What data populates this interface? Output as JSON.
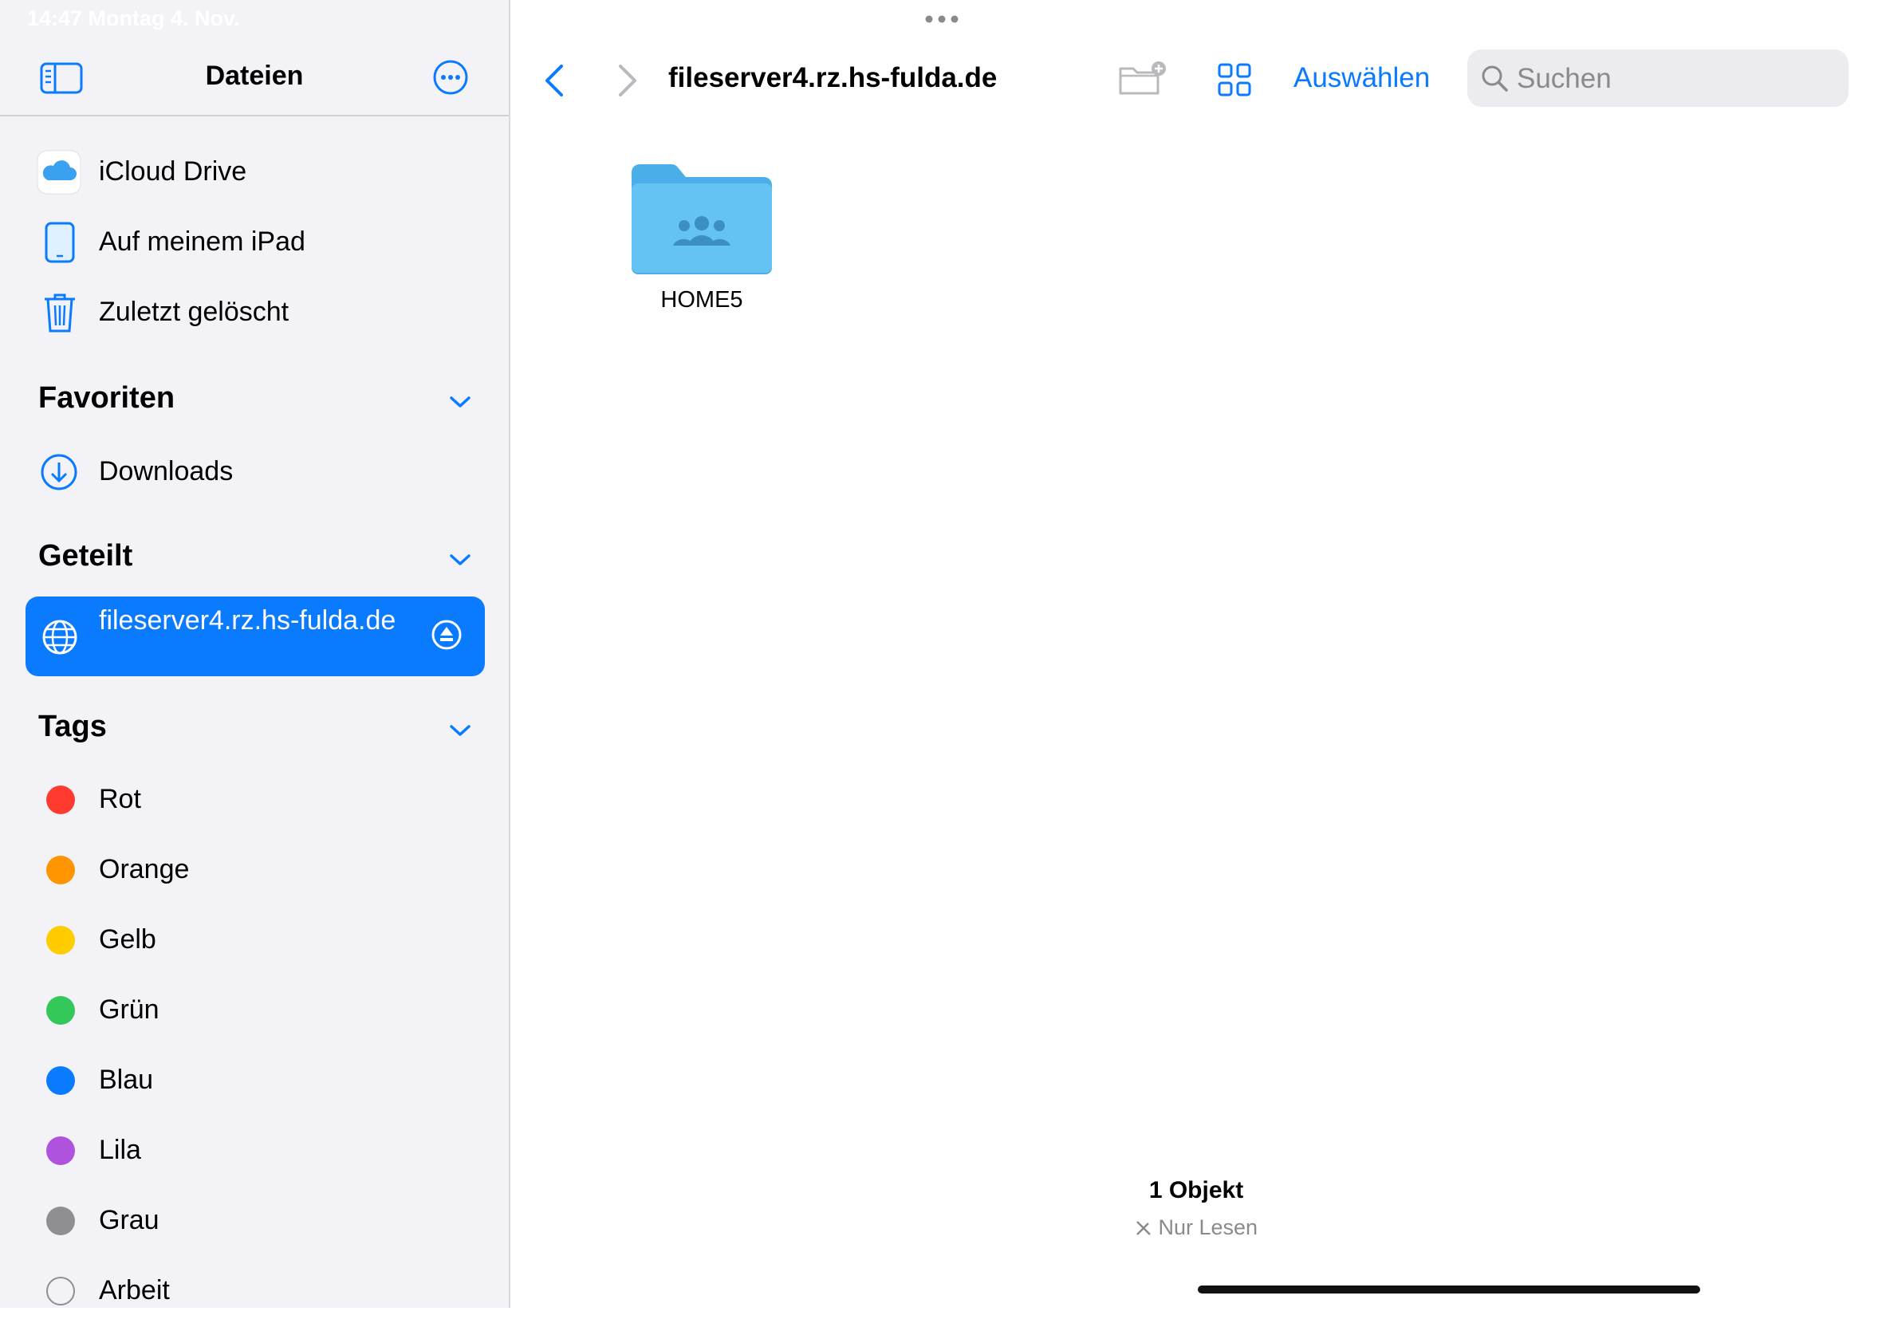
{
  "status_bar": {
    "time": "14:47   Montag 4. Nov."
  },
  "sidebar": {
    "title": "Dateien",
    "locations": [
      {
        "label": "iCloud Drive",
        "icon": "icloud-icon"
      },
      {
        "label": "Auf meinem iPad",
        "icon": "ipad-icon"
      },
      {
        "label": "Zuletzt gelöscht",
        "icon": "trash-icon"
      }
    ],
    "favorites": {
      "title": "Favoriten",
      "items": [
        {
          "label": "Downloads",
          "icon": "download-circle-icon"
        }
      ]
    },
    "shared": {
      "title": "Geteilt",
      "items": [
        {
          "label": "fileserver4.rz.hs-fulda.de",
          "icon": "globe-icon",
          "selected": true
        }
      ]
    },
    "tags": {
      "title": "Tags",
      "items": [
        {
          "label": "Rot",
          "color": "#ff3b30"
        },
        {
          "label": "Orange",
          "color": "#ff9500"
        },
        {
          "label": "Gelb",
          "color": "#ffcc00"
        },
        {
          "label": "Grün",
          "color": "#34c759"
        },
        {
          "label": "Blau",
          "color": "#0a7aff"
        },
        {
          "label": "Lila",
          "color": "#af52de"
        },
        {
          "label": "Grau",
          "color": "#8e8e93"
        },
        {
          "label": "Arbeit",
          "color": ""
        }
      ]
    }
  },
  "toolbar": {
    "path_title": "fileserver4.rz.hs-fulda.de",
    "select_label": "Auswählen",
    "search_placeholder": "Suchen"
  },
  "content": {
    "items": [
      {
        "name": "HOME5",
        "type": "shared-folder"
      }
    ]
  },
  "footer": {
    "count": "1 Objekt",
    "read_only": "Nur Lesen"
  },
  "colors": {
    "accent": "#0a7aff",
    "sidebar_bg": "#f2f2f7",
    "folder": "#5ec4f3"
  }
}
